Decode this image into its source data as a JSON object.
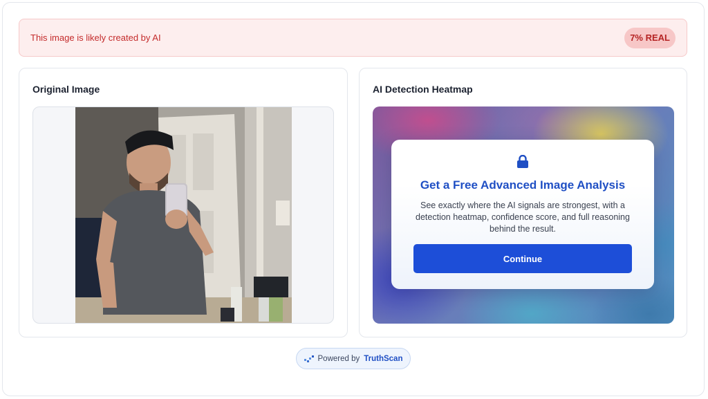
{
  "alert": {
    "message": "This image is likely created by AI",
    "score_label": "7% REAL",
    "status_color": "#c42b2b"
  },
  "original_panel": {
    "title": "Original Image",
    "image_icon": "photo-of-man-taking-mirror-selfie"
  },
  "heatmap_panel": {
    "title": "AI Detection Heatmap",
    "lock_icon": "lock-icon",
    "modal": {
      "title": "Get a Free Advanced Image Analysis",
      "description": "See exactly where the AI signals are strongest, with a detection heatmap, confidence score, and full reasoning behind the result.",
      "button_label": "Continue"
    }
  },
  "footer": {
    "powered_prefix": "Powered by",
    "brand": "TruthScan",
    "icon": "truthscan-logo-icon"
  },
  "colors": {
    "accent": "#1d4ed8",
    "alert_bg": "#fdeeee",
    "badge_bg": "#f7c7c7"
  }
}
